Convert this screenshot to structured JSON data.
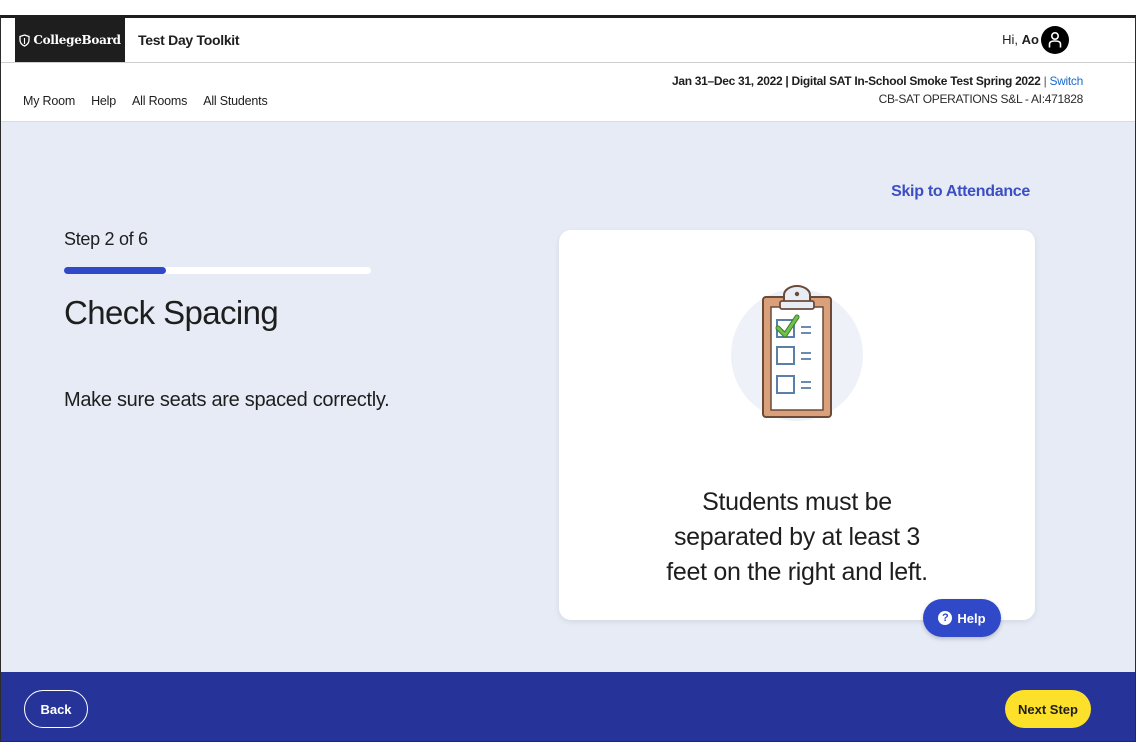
{
  "header": {
    "logo_text": "CollegeBoard",
    "app_title": "Test Day Toolkit",
    "greeting_prefix": "Hi, ",
    "user_name": "Ao"
  },
  "nav": {
    "items": [
      "My Room",
      "Help",
      "All Rooms",
      "All Students"
    ]
  },
  "event": {
    "title": "Jan 31–Dec 31, 2022 | Digital SAT In-School Smoke Test Spring 2022",
    "separator": " | ",
    "switch_label": "Switch",
    "org": "CB-SAT OPERATIONS S&L - AI:471828"
  },
  "main": {
    "skip_link": "Skip to Attendance",
    "step_label": "Step 2 of 6",
    "progress": {
      "current": 2,
      "total": 6
    },
    "title": "Check Spacing",
    "instruction": "Make sure seats are spaced correctly.",
    "card_lines": [
      "Students must be",
      "separated by at least 3",
      "feet on the right and left."
    ],
    "help_label": "Help"
  },
  "footer": {
    "back_label": "Back",
    "next_label": "Next Step"
  },
  "colors": {
    "brand_dark": "#1e1e1e",
    "accent_blue": "#2f49c9",
    "footer_blue": "#26349a",
    "next_yellow": "#fde02a",
    "main_bg": "#e6ebf5",
    "link_blue": "#1a6ad0"
  },
  "icons": {
    "logo": "acorn-shield-icon",
    "avatar": "user-icon",
    "illustration": "clipboard-checklist-icon",
    "help": "question-circle-icon"
  }
}
